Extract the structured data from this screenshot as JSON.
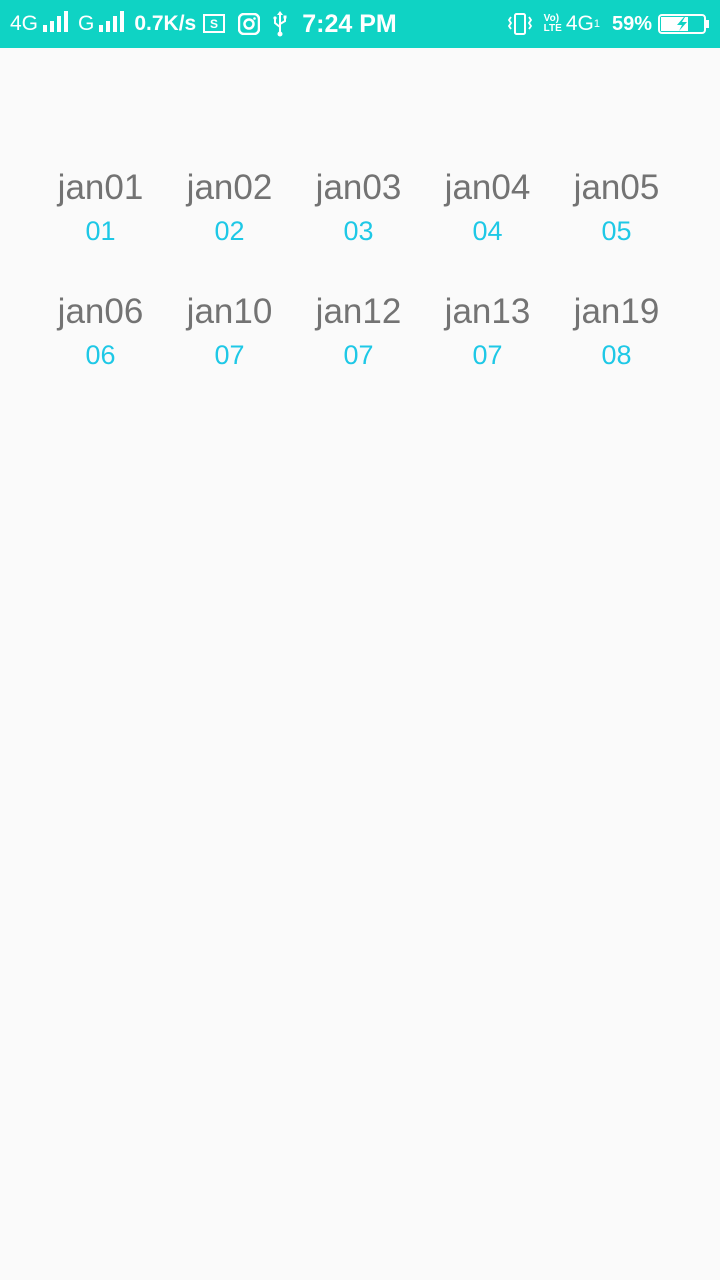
{
  "status_bar": {
    "net1": "4G",
    "net2": "G",
    "speed": "0.7K/s",
    "time": "7:24 PM",
    "volte_top": "Vo)",
    "volte_bottom": "LTE",
    "net3": "4G",
    "net3_sub": "1",
    "battery": "59%",
    "icons": [
      "signal-bars-icon",
      "signal-bars-icon",
      "screenshot-icon",
      "instagram-icon",
      "usb-icon",
      "vibrate-icon",
      "battery-charging-icon"
    ]
  },
  "colors": {
    "status_bar": "#0fd3c4",
    "name_text": "#737373",
    "number_text": "#1ec8e6",
    "background": "#fafafa"
  },
  "items": [
    {
      "name": "jan01",
      "value": "01"
    },
    {
      "name": "jan02",
      "value": "02"
    },
    {
      "name": "jan03",
      "value": "03"
    },
    {
      "name": "jan04",
      "value": "04"
    },
    {
      "name": "jan05",
      "value": "05"
    },
    {
      "name": "jan06",
      "value": "06"
    },
    {
      "name": "jan10",
      "value": "07"
    },
    {
      "name": "jan12",
      "value": "07"
    },
    {
      "name": "jan13",
      "value": "07"
    },
    {
      "name": "jan19",
      "value": "08"
    }
  ]
}
